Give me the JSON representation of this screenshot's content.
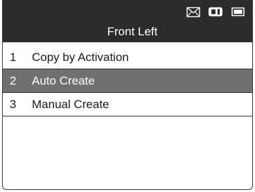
{
  "header": {
    "title": "Front Left",
    "icons": [
      "mail-icon",
      "vehicle-icon",
      "battery-icon"
    ]
  },
  "menu": {
    "selected_index": 1,
    "items": [
      {
        "number": "1",
        "label": "Copy by Activation"
      },
      {
        "number": "2",
        "label": "Auto Create"
      },
      {
        "number": "3",
        "label": "Manual Create"
      }
    ]
  },
  "colors": {
    "header_bg": "#2b2b2b",
    "selected_bg": "#707070",
    "text": "#1a1a1a"
  }
}
